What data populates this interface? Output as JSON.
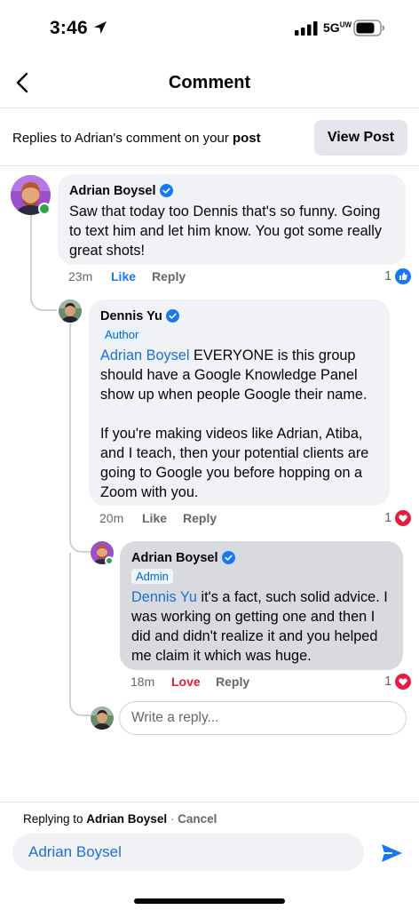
{
  "status_bar": {
    "time": "3:46",
    "network": "5G",
    "network_super": "UW",
    "icons": [
      "location-arrow-icon",
      "signal-bars-icon",
      "battery-icon"
    ]
  },
  "header": {
    "title": "Comment",
    "back_icon": "chevron-left-icon"
  },
  "replies_bar": {
    "prefix": "Replies to Adrian's comment on your ",
    "post_word": "post",
    "view_post_label": "View Post"
  },
  "comments": [
    {
      "author": "Adrian Boysel",
      "verified": true,
      "role": "",
      "mention": "",
      "paragraphs": [
        "Saw that today too Dennis that's so funny. Going to text him and let him know. You got some really great shots!"
      ],
      "time": "23m",
      "like_label": "Like",
      "reply_label": "Reply",
      "reaction_count": "1",
      "reaction_type": "like"
    },
    {
      "author": "Dennis Yu",
      "verified": true,
      "role": "Author",
      "mention": "Adrian Boysel",
      "paragraphs": [
        " EVERYONE is this group should have a Google Knowledge Panel show up when people Google their name.",
        "If you're making videos like Adrian, Atiba, and I teach, then your potential clients are going to Google you before hopping on a Zoom with you."
      ],
      "time": "20m",
      "like_label": "Like",
      "reply_label": "Reply",
      "reaction_count": "1",
      "reaction_type": "love"
    },
    {
      "author": "Adrian Boysel",
      "verified": true,
      "role": "Admin",
      "mention": "Dennis Yu",
      "paragraphs": [
        " it's a fact, such solid advice. I was working on getting one and then I did and didn't realize it and you helped me claim it which was huge."
      ],
      "time": "18m",
      "like_label": "Love",
      "reply_label": "Reply",
      "reaction_count": "1",
      "reaction_type": "love"
    }
  ],
  "write_reply": {
    "placeholder": "Write a reply..."
  },
  "composer": {
    "replying_prefix": "Replying to ",
    "replying_name": "Adrian Boysel",
    "separator": " · ",
    "cancel_label": "Cancel",
    "input_value": "Adrian Boysel",
    "send_icon": "send-arrow-icon"
  },
  "colors": {
    "accent": "#1877f2",
    "mention": "#1b6fd8",
    "love": "#e41e3f",
    "online": "#31a24c",
    "bubble": "#f0f2f5",
    "bubble_highlight": "#d8dadf"
  }
}
